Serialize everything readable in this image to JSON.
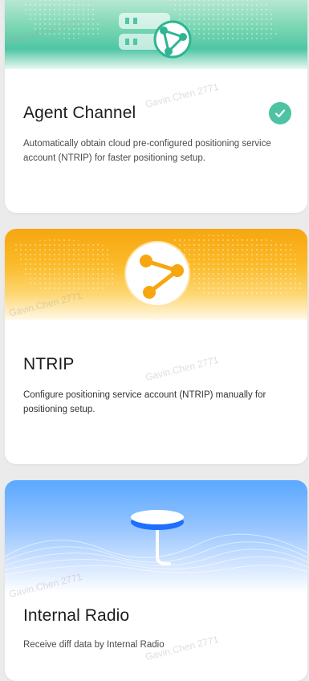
{
  "cards": [
    {
      "title": "Agent Channel",
      "description": "Automatically obtain cloud pre-configured positioning service account (NTRIP) for faster positioning setup.",
      "selected": true,
      "icon": "network-globe-icon",
      "accent": "#4ec3a4"
    },
    {
      "title": "NTRIP",
      "description": "Configure positioning service account (NTRIP) manually for positioning setup.",
      "selected": false,
      "icon": "network-globe-icon",
      "accent": "#f7a60f"
    },
    {
      "title": "Internal Radio",
      "description": "Receive diff data by Internal Radio",
      "selected": false,
      "icon": "radio-antenna-icon",
      "accent": "#2f80ff"
    }
  ],
  "watermark": "Gavin.Chen 2771"
}
